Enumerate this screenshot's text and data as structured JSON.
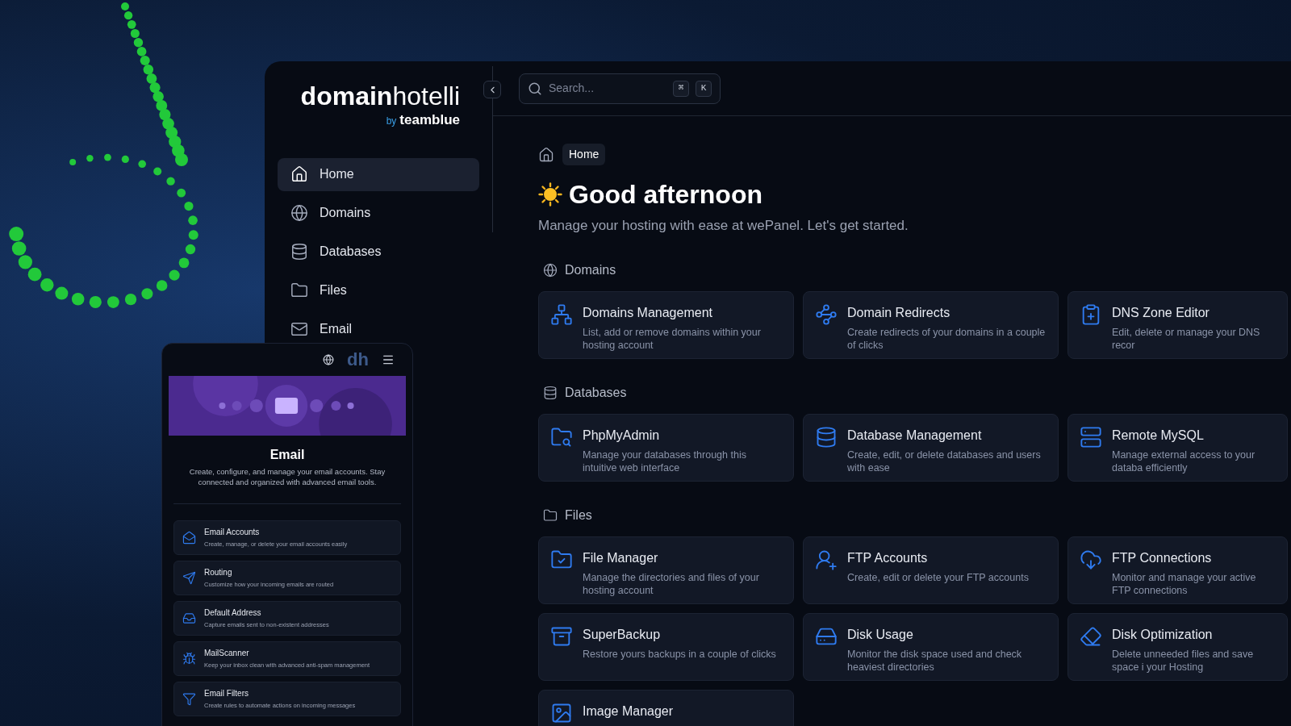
{
  "logo": {
    "bold": "domain",
    "light": "hotelli",
    "by": "by",
    "brand": "teamblue"
  },
  "sidebar": {
    "items": [
      {
        "label": "Home",
        "selected": true
      },
      {
        "label": "Domains",
        "selected": false
      },
      {
        "label": "Databases",
        "selected": false
      },
      {
        "label": "Files",
        "selected": false
      },
      {
        "label": "Email",
        "selected": false
      }
    ]
  },
  "search": {
    "placeholder": "Search...",
    "keys": [
      "⌘",
      "K"
    ]
  },
  "breadcrumb": "Home",
  "greeting": "Good afternoon",
  "subtitle": "Manage your hosting with ease at wePanel. Let's get started.",
  "sections": [
    {
      "title": "Domains",
      "cards": [
        {
          "title": "Domains Management",
          "description": "List, add or remove domains within your hosting account"
        },
        {
          "title": "Domain Redirects",
          "description": "Create redirects of your domains in a couple of clicks"
        },
        {
          "title": "DNS Zone Editor",
          "description": "Edit, delete or manage your DNS recor"
        }
      ]
    },
    {
      "title": "Databases",
      "cards": [
        {
          "title": "PhpMyAdmin",
          "description": "Manage your databases through this intuitive web interface"
        },
        {
          "title": "Database Management",
          "description": "Create, edit, or delete databases and users with ease"
        },
        {
          "title": "Remote MySQL",
          "description": "Manage external access to your databa efficiently"
        }
      ]
    },
    {
      "title": "Files",
      "cards": [
        {
          "title": "File Manager",
          "description": "Manage the directories and files of your hosting account"
        },
        {
          "title": "FTP Accounts",
          "description": "Create, edit or delete your FTP accounts"
        },
        {
          "title": "FTP Connections",
          "description": "Monitor and manage your active FTP connections"
        },
        {
          "title": "SuperBackup",
          "description": "Restore yours backups in a couple of clicks"
        },
        {
          "title": "Disk Usage",
          "description": "Monitor the disk space used and check heaviest directories"
        },
        {
          "title": "Disk Optimization",
          "description": "Delete unneeded files and save space i your Hosting"
        },
        {
          "title": "Image Manager"
        }
      ]
    }
  ],
  "mobile": {
    "logo": "dh",
    "title": "Email",
    "description": "Create, configure, and manage your email accounts. Stay connected and organized with advanced email tools.",
    "items": [
      {
        "title": "Email Accounts",
        "description": "Create, manage, or delete your email accounts easily"
      },
      {
        "title": "Routing",
        "description": "Customize how your incoming emails are routed"
      },
      {
        "title": "Default Address",
        "description": "Capture emails sent to non-existent addresses"
      },
      {
        "title": "MailScanner",
        "description": "Keep your inbox clean with advanced anti-spam management"
      },
      {
        "title": "Email Filters",
        "description": "Create rules to automate actions on incoming messages"
      }
    ]
  }
}
